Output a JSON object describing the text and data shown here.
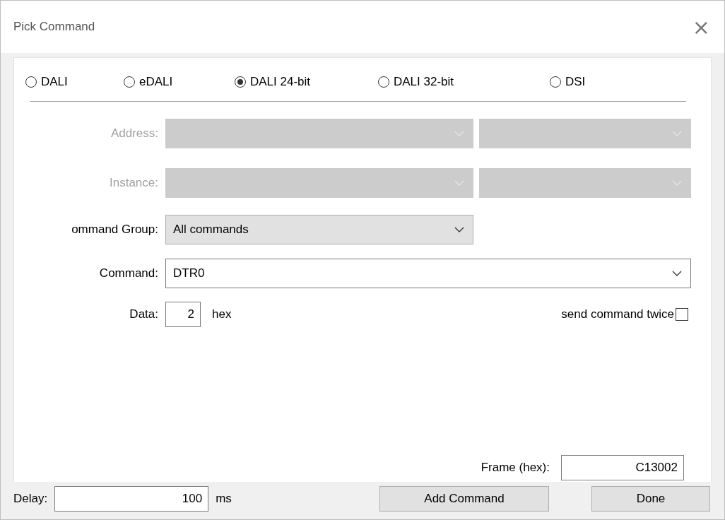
{
  "window": {
    "title": "Pick Command",
    "close": "×"
  },
  "protocols": [
    {
      "label": "DALI",
      "selected": false
    },
    {
      "label": "eDALI",
      "selected": false
    },
    {
      "label": "DALI 24-bit",
      "selected": true
    },
    {
      "label": "DALI 32-bit",
      "selected": false
    },
    {
      "label": "DSI",
      "selected": false
    }
  ],
  "address": {
    "label": "Address:",
    "disabled": true
  },
  "instance": {
    "label": "Instance:",
    "disabled": true
  },
  "command_group": {
    "label": "ommand Group:",
    "value": "All commands",
    "disabled": false
  },
  "command": {
    "label": "Command:",
    "value": "DTR0",
    "disabled": false
  },
  "data": {
    "label": "Data:",
    "value": "2",
    "unit": "hex"
  },
  "send_twice": {
    "label": "send command twice",
    "checked": false
  },
  "frame": {
    "label": "Frame (hex):",
    "value": "C13002"
  },
  "delay": {
    "label": "Delay:",
    "value": "100",
    "unit": "ms"
  },
  "buttons": [
    "Add Command",
    "Done"
  ]
}
